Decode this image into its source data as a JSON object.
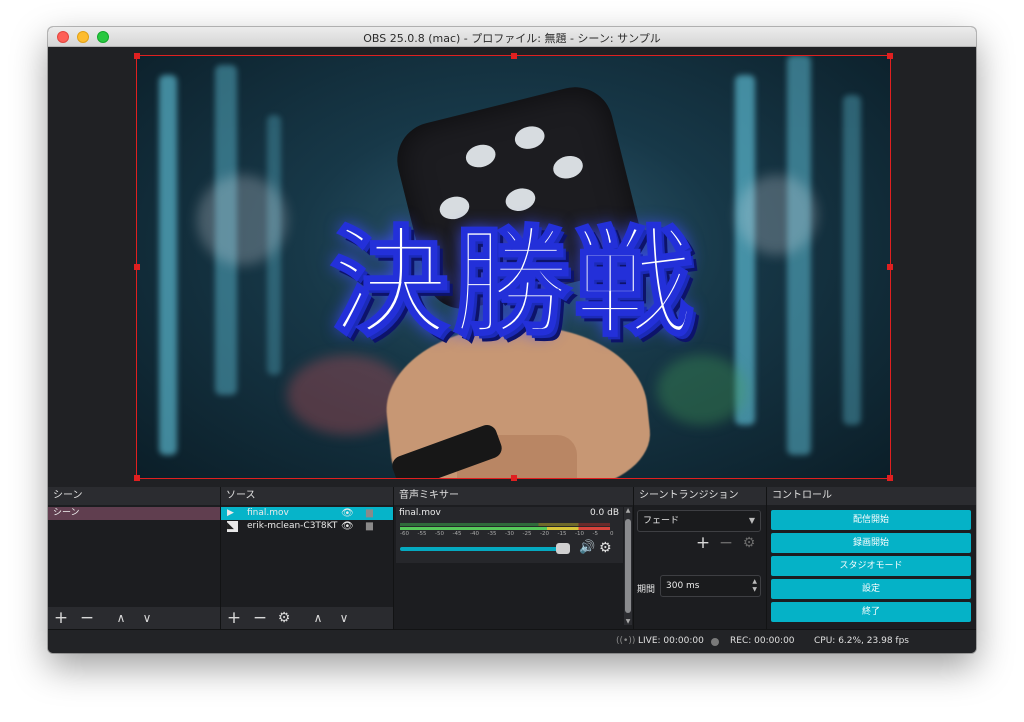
{
  "window": {
    "title": "OBS 25.0.8 (mac) - プロファイル: 無題 - シーン: サンプル"
  },
  "preview": {
    "overlay_text": "決勝戦"
  },
  "scenes": {
    "title": "シーン",
    "items": [
      "シーン"
    ],
    "toolbar": {
      "add": "+",
      "remove": "−",
      "up": "∧",
      "down": "∨"
    }
  },
  "sources": {
    "title": "ソース",
    "items": [
      {
        "label": "final.mov",
        "icon": "play-icon",
        "selected": true
      },
      {
        "label": "erik-mclean-C3T8KT",
        "icon": "image-icon",
        "selected": false
      }
    ],
    "eye_glyph": "👁",
    "toolbar": {
      "add": "+",
      "remove": "−",
      "settings": "⚙",
      "up": "∧",
      "down": "∨"
    }
  },
  "mixer": {
    "title": "音声ミキサー",
    "track": {
      "name": "final.mov",
      "level": "0.0 dB",
      "ticks": [
        "-60",
        "-55",
        "-50",
        "-45",
        "-40",
        "-35",
        "-30",
        "-25",
        "-20",
        "-15",
        "-10",
        "-5",
        "0"
      ],
      "volume_fraction": 0.95
    }
  },
  "transitions": {
    "title": "シーントランジション",
    "selected": "フェード",
    "duration_label": "期間",
    "duration_value": "300 ms"
  },
  "controls": {
    "title": "コントロール",
    "buttons": [
      "配信開始",
      "録画開始",
      "スタジオモード",
      "設定",
      "終了"
    ]
  },
  "status": {
    "live": "LIVE: 00:00:00",
    "rec": "REC: 00:00:00",
    "cpu": "CPU: 6.2%, 23.98 fps"
  },
  "colors": {
    "accent": "#05b2c7",
    "selection": "#e02020",
    "scene_selected": "#603e4f"
  }
}
